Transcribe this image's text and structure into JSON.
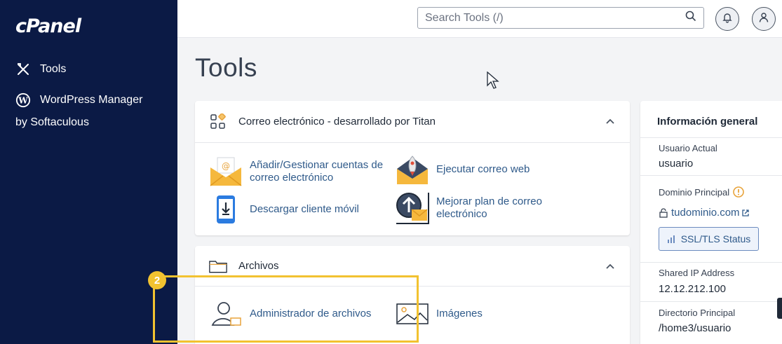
{
  "sidebar": {
    "logo": "cPanel",
    "items": [
      {
        "label": "Tools",
        "icon": "tools-icon"
      },
      {
        "label": "WordPress Manager",
        "label2": "by Softaculous",
        "icon": "wordpress-icon"
      }
    ]
  },
  "header": {
    "search_placeholder": "Search Tools (/)",
    "icons": [
      "search-icon",
      "bell-icon",
      "user-icon"
    ]
  },
  "page": {
    "title": "Tools"
  },
  "cards": {
    "email": {
      "title": "Correo electrónico - desarrollado por Titan",
      "tools": [
        {
          "label": "Añadir/Gestionar cuentas de correo electrónico",
          "icon": "email-accounts-icon"
        },
        {
          "label": "Ejecutar correo web",
          "icon": "webmail-rocket-icon"
        },
        {
          "label": "Descargar cliente móvil",
          "icon": "mobile-download-icon"
        },
        {
          "label": "Mejorar plan de correo electrónico",
          "icon": "upgrade-email-icon"
        }
      ]
    },
    "files": {
      "title": "Archivos",
      "tools": [
        {
          "label": "Administrador de archivos",
          "icon": "file-manager-icon"
        },
        {
          "label": "Imágenes",
          "icon": "images-icon"
        }
      ]
    }
  },
  "info": {
    "title": "Información general",
    "current_user_label": "Usuario Actual",
    "current_user": "usuario",
    "primary_domain_label": "Dominio Principal",
    "primary_domain": "tudominio.com",
    "ssl_button": "SSL/TLS Status",
    "shared_ip_label": "Shared IP Address",
    "shared_ip": "12.12.212.100",
    "home_dir_label": "Directorio Principal",
    "home_dir": "/home3/usuario"
  },
  "annotation": {
    "badge": "2",
    "color": "#f2c230"
  },
  "colors": {
    "sidebar": "#0b1a45",
    "link": "#2f5a8a",
    "highlight": "#f2c230"
  }
}
